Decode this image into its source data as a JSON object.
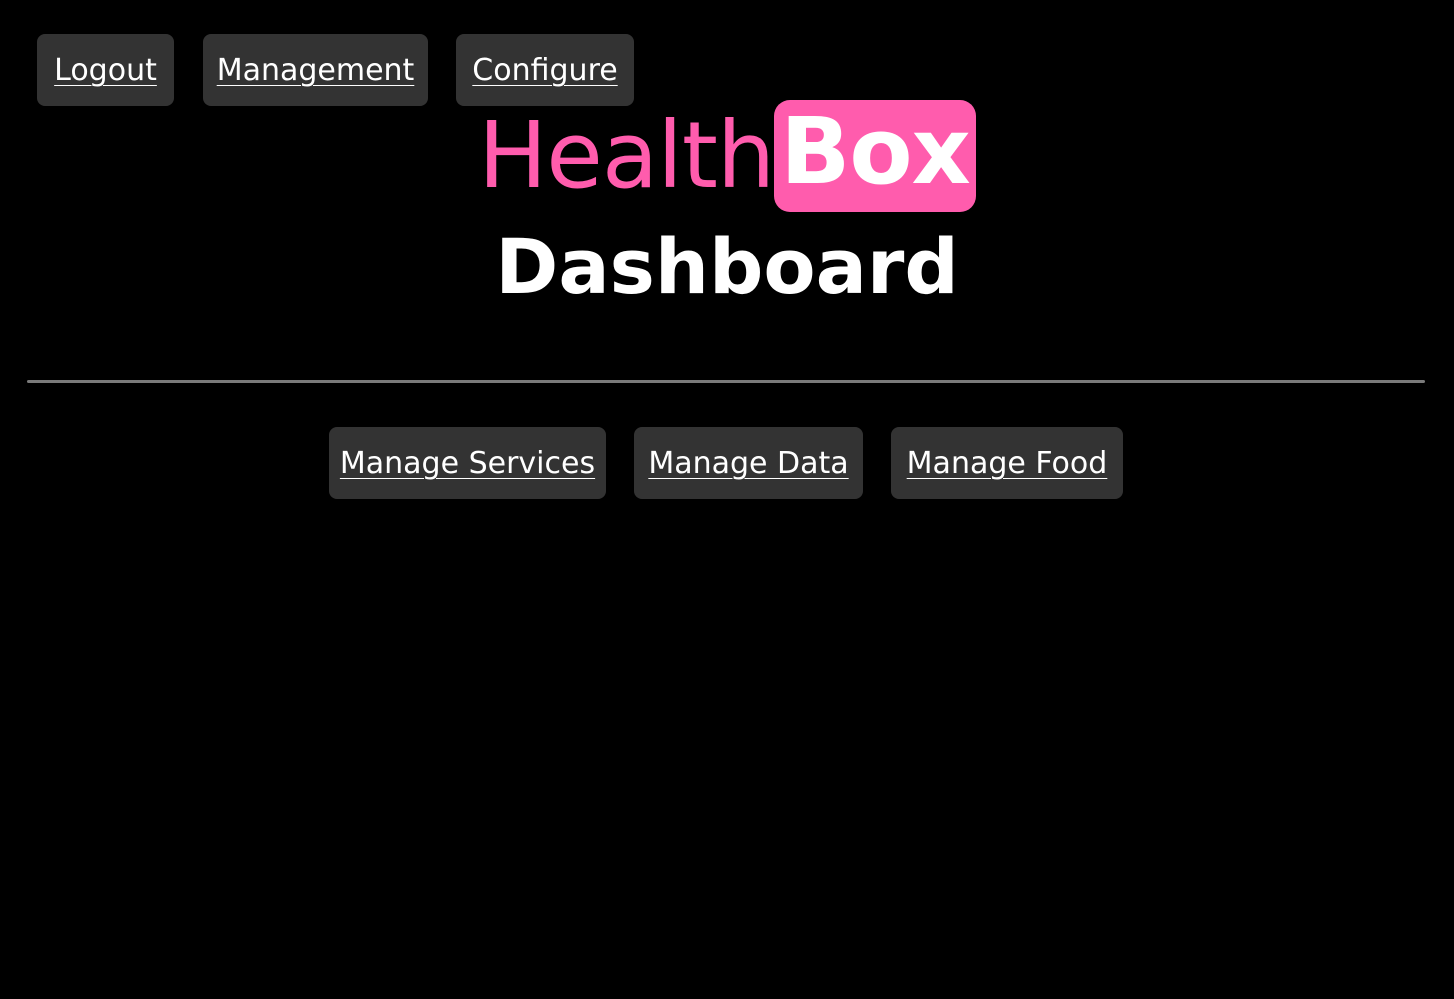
{
  "nav": {
    "logout_label": "Logout",
    "management_label": "Management",
    "configure_label": "Configure"
  },
  "brand": {
    "part1": "Health",
    "part2": "Box",
    "accent_color": "#ff5cad"
  },
  "page_title": "Dashboard",
  "actions": {
    "manage_services_label": "Manage Services",
    "manage_data_label": "Manage Data",
    "manage_food_label": "Manage Food"
  },
  "colors": {
    "background": "#000000",
    "button_bg": "#333333",
    "divider": "#7a7a7a",
    "text": "#ffffff"
  }
}
